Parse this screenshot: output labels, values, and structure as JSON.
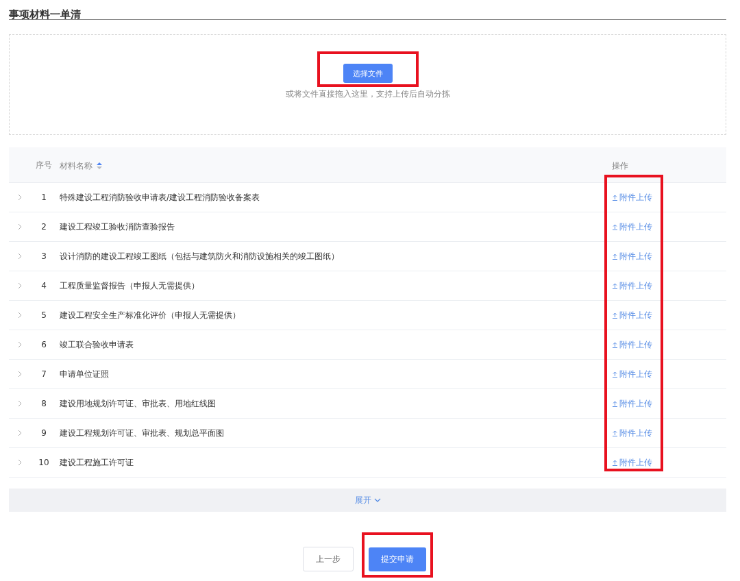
{
  "section_title": "事项材料一单清",
  "upload": {
    "button": "选择文件",
    "hint": "或将文件直接拖入这里，支持上传后自动分拣",
    "highlighted": true
  },
  "table": {
    "columns": [
      {
        "label": "序号"
      },
      {
        "label": "材料名称",
        "sortable": true
      },
      {
        "label": "操作"
      }
    ],
    "action_highlighted": true,
    "rows": [
      {
        "index": "1",
        "name": "特殊建设工程消防验收申请表/建设工程消防验收备案表",
        "action": "附件上传",
        "expanded": false
      },
      {
        "index": "2",
        "name": "建设工程竣工验收消防查验报告",
        "action": "附件上传",
        "expanded": false
      },
      {
        "index": "3",
        "name": "设计消防的建设工程竣工图纸（包括与建筑防火和消防设施相关的竣工图纸）",
        "action": "附件上传",
        "expanded": false
      },
      {
        "index": "4",
        "name": "工程质量监督报告（申报人无需提供）",
        "action": "附件上传",
        "expanded": false
      },
      {
        "index": "5",
        "name": "建设工程安全生产标准化评价（申报人无需提供）",
        "action": "附件上传",
        "expanded": false
      },
      {
        "index": "6",
        "name": "竣工联合验收申请表",
        "action": "附件上传",
        "expanded": false
      },
      {
        "index": "7",
        "name": "申请单位证照",
        "action": "附件上传",
        "expanded": false
      },
      {
        "index": "8",
        "name": "建设用地规划许可证、审批表、用地红线图",
        "action": "附件上传",
        "expanded": false
      },
      {
        "index": "9",
        "name": "建设工程规划许可证、审批表、规划总平面图",
        "action": "附件上传",
        "expanded": false
      },
      {
        "index": "10",
        "name": "建设工程施工许可证",
        "action": "附件上传",
        "expanded": false
      }
    ]
  },
  "expand_bar": {
    "label": "展开"
  },
  "footer": {
    "buttons": [
      {
        "label": "上一步",
        "kind": "secondary",
        "highlighted": false
      },
      {
        "label": "提交申请",
        "kind": "primary",
        "highlighted": true
      }
    ]
  }
}
